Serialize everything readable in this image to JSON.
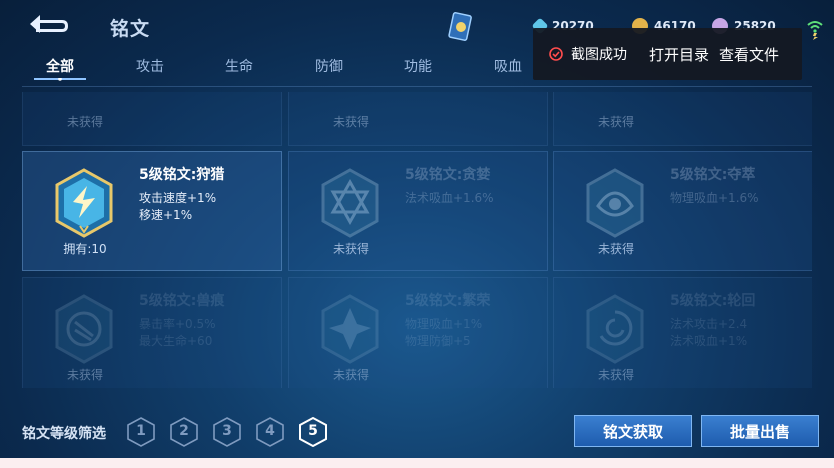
{
  "header": {
    "title": "铭文"
  },
  "currencies": [
    {
      "icon": "diamond-icon",
      "value": "20270",
      "color": "#5fc6e8"
    },
    {
      "icon": "gold-coin-icon",
      "value": "46170",
      "color": "#e3b34a"
    },
    {
      "icon": "pearl-icon",
      "value": "25820",
      "color": "#c7a6e6"
    }
  ],
  "tabs": [
    "全部",
    "攻击",
    "生命",
    "防御",
    "功能",
    "吸血"
  ],
  "toast": {
    "message": "截图成功",
    "open_dir": "打开目录",
    "view_file": "查看文件"
  },
  "cards": {
    "top": [
      {
        "status": "未获得"
      },
      {
        "status": "未获得"
      },
      {
        "status": "未获得"
      }
    ],
    "middle": [
      {
        "name": "5级铭文:狩猎",
        "attrs": [
          "攻击速度+1%",
          "移速+1%"
        ],
        "status": "拥有:10"
      },
      {
        "name": "5级铭文:贪婪",
        "attrs": [
          "法术吸血+1.6%"
        ],
        "status": "未获得"
      },
      {
        "name": "5级铭文:夺萃",
        "attrs": [
          "物理吸血+1.6%"
        ],
        "status": "未获得"
      }
    ],
    "bottom": [
      {
        "name": "5级铭文:兽痕",
        "attrs": [
          "暴击率+0.5%",
          "最大生命+60"
        ],
        "status": "未获得"
      },
      {
        "name": "5级铭文:繁荣",
        "attrs": [
          "物理吸血+1%",
          "物理防御+5"
        ],
        "status": "未获得"
      },
      {
        "name": "5级铭文:轮回",
        "attrs": [
          "法术攻击+2.4",
          "法术吸血+1%"
        ],
        "status": "未获得"
      }
    ]
  },
  "filter": {
    "label": "铭文等级筛选",
    "levels": [
      "1",
      "2",
      "3",
      "4",
      "5"
    ],
    "selected": "5"
  },
  "buttons": {
    "acquire": "铭文获取",
    "bulk_sell": "批量出售"
  }
}
